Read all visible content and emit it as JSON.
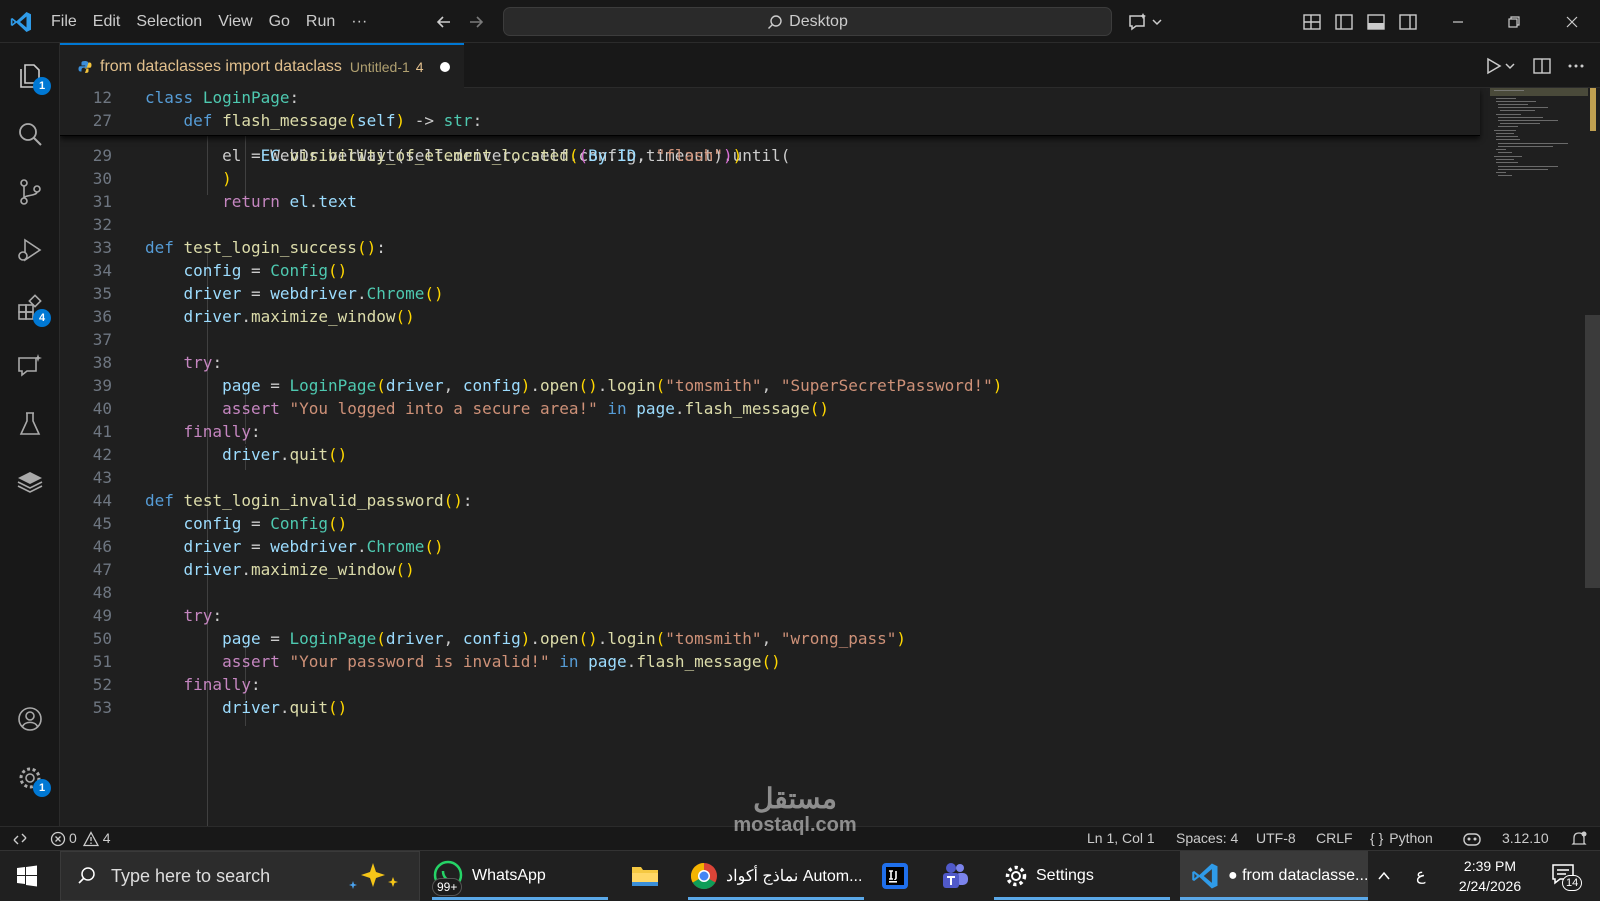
{
  "titlebar": {
    "menu": [
      "File",
      "Edit",
      "Selection",
      "View",
      "Go",
      "Run",
      "···"
    ],
    "search_text": "Desktop"
  },
  "activity_badges": {
    "explorer": "1",
    "extensions": "4",
    "settings": "1"
  },
  "tab": {
    "title": "from dataclasses import dataclass",
    "description": "Untitled-1",
    "problem_count": "4"
  },
  "sticky": [
    {
      "ln": "12",
      "code": "class LoginPage:"
    },
    {
      "ln": "27",
      "code": "    def flash_message(self) -> str:"
    }
  ],
  "partial_line": "        el = WebDriverWait(self.driver, self.config.timeout).until(",
  "code_lines": [
    {
      "ln": "29",
      "code": "            EC.visibility_of_element_located((By.ID, \"flash\"))"
    },
    {
      "ln": "30",
      "code": "        )"
    },
    {
      "ln": "31",
      "code": "        return el.text"
    },
    {
      "ln": "32",
      "code": ""
    },
    {
      "ln": "33",
      "code": "def test_login_success():"
    },
    {
      "ln": "34",
      "code": "    config = Config()"
    },
    {
      "ln": "35",
      "code": "    driver = webdriver.Chrome()"
    },
    {
      "ln": "36",
      "code": "    driver.maximize_window()"
    },
    {
      "ln": "37",
      "code": ""
    },
    {
      "ln": "38",
      "code": "    try:"
    },
    {
      "ln": "39",
      "code": "        page = LoginPage(driver, config).open().login(\"tomsmith\", \"SuperSecretPassword!\")"
    },
    {
      "ln": "40",
      "code": "        assert \"You logged into a secure area!\" in page.flash_message()"
    },
    {
      "ln": "41",
      "code": "    finally:"
    },
    {
      "ln": "42",
      "code": "        driver.quit()"
    },
    {
      "ln": "43",
      "code": ""
    },
    {
      "ln": "44",
      "code": "def test_login_invalid_password():"
    },
    {
      "ln": "45",
      "code": "    config = Config()"
    },
    {
      "ln": "46",
      "code": "    driver = webdriver.Chrome()"
    },
    {
      "ln": "47",
      "code": "    driver.maximize_window()"
    },
    {
      "ln": "48",
      "code": ""
    },
    {
      "ln": "49",
      "code": "    try:"
    },
    {
      "ln": "50",
      "code": "        page = LoginPage(driver, config).open().login(\"tomsmith\", \"wrong_pass\")"
    },
    {
      "ln": "51",
      "code": "        assert \"Your password is invalid!\" in page.flash_message()"
    },
    {
      "ln": "52",
      "code": "    finally:"
    },
    {
      "ln": "53",
      "code": "        driver.quit()"
    }
  ],
  "statusbar": {
    "errors": "0",
    "warnings": "4",
    "position": "Ln 1, Col 1",
    "spaces": "Spaces: 4",
    "encoding": "UTF-8",
    "eol": "CRLF",
    "language": "Python",
    "version": "3.12.10"
  },
  "taskbar": {
    "search_placeholder": "Type here to search",
    "whatsapp": "WhatsApp",
    "whatsapp_badge": "99+",
    "chrome": "نماذج أكواد Autom...",
    "settings": "Settings",
    "vscode": "● from dataclasse...",
    "lang": "ع",
    "time": "2:39 PM",
    "date": "2/24/2026",
    "notifications": "14"
  },
  "watermark": {
    "arabic": "مستقل",
    "latin": "mostaql.com"
  },
  "colors": {
    "accent": "#0078d4",
    "editor_bg": "#1f1f1f",
    "tab_modified": "#e2c08d"
  }
}
